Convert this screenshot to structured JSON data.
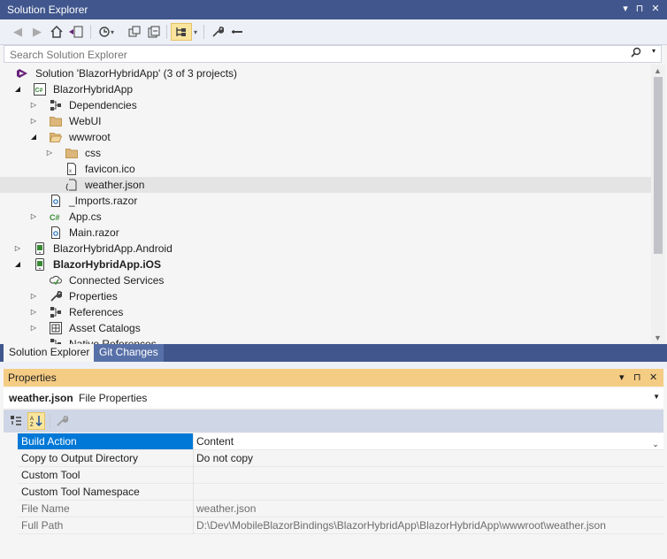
{
  "solution_explorer": {
    "title": "Solution Explorer",
    "title_buttons": [
      "▾",
      "⊓",
      "✕"
    ],
    "search_placeholder": "Search Solution Explorer",
    "tree": [
      {
        "label": "Solution 'BlazorHybridApp' (3 of 3 projects)",
        "icon": "solution-icon",
        "level": 0,
        "arrow": "none"
      },
      {
        "label": "BlazorHybridApp",
        "icon": "csharp-project-icon",
        "level": 1,
        "arrow": "expanded"
      },
      {
        "label": "Dependencies",
        "icon": "dependencies-icon",
        "level": 2,
        "arrow": "collapsed"
      },
      {
        "label": "WebUI",
        "icon": "folder-icon",
        "level": 2,
        "arrow": "collapsed"
      },
      {
        "label": "wwwroot",
        "icon": "folder-open-icon",
        "level": 2,
        "arrow": "expanded"
      },
      {
        "label": "css",
        "icon": "folder-icon",
        "level": 3,
        "arrow": "collapsed"
      },
      {
        "label": "favicon.ico",
        "icon": "ico-file-icon",
        "level": 3,
        "arrow": "none"
      },
      {
        "label": "weather.json",
        "icon": "json-file-icon",
        "level": 3,
        "arrow": "none",
        "selected": true
      },
      {
        "label": "_Imports.razor",
        "icon": "razor-file-icon",
        "level": 2,
        "arrow": "none"
      },
      {
        "label": "App.cs",
        "icon": "csharp-file-icon",
        "level": 2,
        "arrow": "collapsed"
      },
      {
        "label": "Main.razor",
        "icon": "razor-file-icon",
        "level": 2,
        "arrow": "none"
      },
      {
        "label": "BlazorHybridApp.Android",
        "icon": "android-project-icon",
        "level": 1,
        "arrow": "collapsed"
      },
      {
        "label": "BlazorHybridApp.iOS",
        "icon": "ios-project-icon",
        "level": 1,
        "arrow": "expanded",
        "bold": true
      },
      {
        "label": "Connected Services",
        "icon": "connected-services-icon",
        "level": 2,
        "arrow": "none"
      },
      {
        "label": "Properties",
        "icon": "wrench-icon",
        "level": 2,
        "arrow": "collapsed"
      },
      {
        "label": "References",
        "icon": "references-icon",
        "level": 2,
        "arrow": "collapsed"
      },
      {
        "label": "Asset Catalogs",
        "icon": "asset-catalog-icon",
        "level": 2,
        "arrow": "collapsed"
      },
      {
        "label": "Native References",
        "icon": "references-icon",
        "level": 2,
        "arrow": "none"
      }
    ]
  },
  "tabs": [
    {
      "label": "Solution Explorer",
      "active": true
    },
    {
      "label": "Git Changes",
      "active": false
    }
  ],
  "properties": {
    "title": "Properties",
    "title_buttons": [
      "▾",
      "⊓",
      "✕"
    ],
    "object_name": "weather.json",
    "object_type": "File Properties",
    "rows": [
      {
        "name": "Build Action",
        "value": "Content",
        "selected": true,
        "readonly": false
      },
      {
        "name": "Copy to Output Directory",
        "value": "Do not copy",
        "selected": false,
        "readonly": false
      },
      {
        "name": "Custom Tool",
        "value": "",
        "selected": false,
        "readonly": false
      },
      {
        "name": "Custom Tool Namespace",
        "value": "",
        "selected": false,
        "readonly": false
      },
      {
        "name": "File Name",
        "value": "weather.json",
        "selected": false,
        "readonly": true
      },
      {
        "name": "Full Path",
        "value": "D:\\Dev\\MobileBlazorBindings\\BlazorHybridApp\\BlazorHybridApp\\wwwroot\\weather.json",
        "selected": false,
        "readonly": true
      }
    ]
  },
  "colors": {
    "title_bar": "#40568d",
    "properties_title": "#f5cc84",
    "selection_blue": "#0078d7",
    "toggle_highlight": "#f9e59d"
  }
}
